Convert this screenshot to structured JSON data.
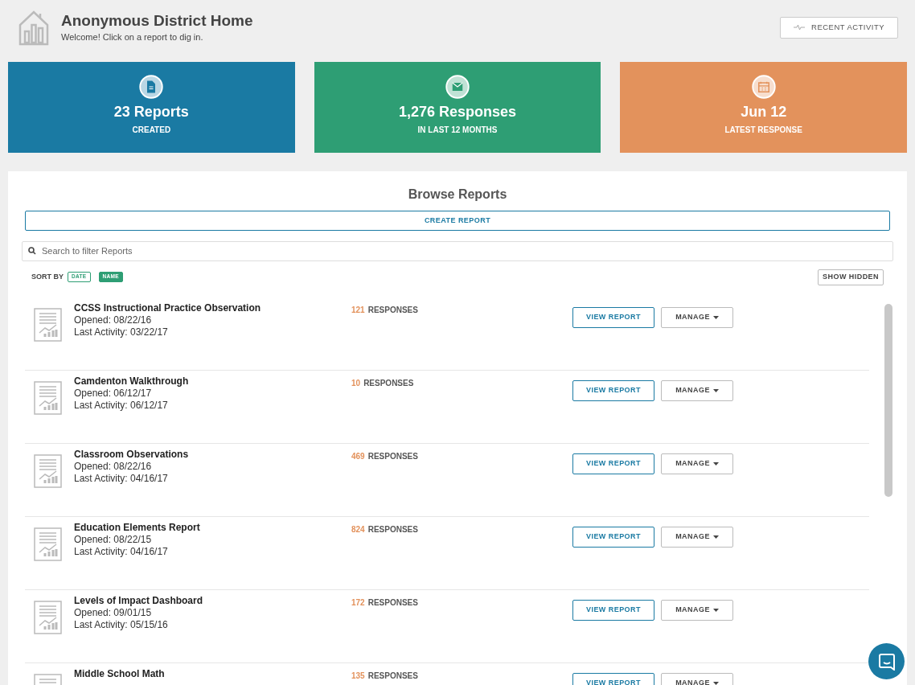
{
  "header": {
    "title": "Anonymous District Home",
    "subtitle": "Welcome! Click on a report to dig in.",
    "recent_activity_button": "RECENT ACTIVITY"
  },
  "stats": [
    {
      "kind": "document",
      "value": "23 Reports",
      "label": "CREATED",
      "color": "#1a7aa3"
    },
    {
      "kind": "envelope",
      "value": "1,276 Responses",
      "label": "IN LAST 12 MONTHS",
      "color": "#2e9e74"
    },
    {
      "kind": "calendar",
      "value": "Jun 12",
      "label": "LATEST RESPONSE",
      "color": "#e3925c"
    }
  ],
  "browse": {
    "title": "Browse Reports",
    "create_button": "CREATE REPORT",
    "search": {
      "placeholder": "Search to filter Reports"
    },
    "sort_label": "SORT BY",
    "sort_options": [
      {
        "label": "DATE",
        "selected": false
      },
      {
        "label": "NAME",
        "selected": true
      }
    ],
    "show_hidden_button": "SHOW HIDDEN",
    "reports": [
      {
        "title": "CCSS Instructional Practice Observation",
        "opened": "Opened: 08/22/16",
        "last_activity": "Last Activity: 03/22/17",
        "count": "121",
        "responses_label": "RESPONSES",
        "view_button": "VIEW REPORT",
        "manage_button": "MANAGE"
      },
      {
        "title": "Camdenton Walkthrough",
        "opened": "Opened: 06/12/17",
        "last_activity": "Last Activity: 06/12/17",
        "count": "10",
        "responses_label": "RESPONSES",
        "view_button": "VIEW REPORT",
        "manage_button": "MANAGE"
      },
      {
        "title": "Classroom Observations",
        "opened": "Opened: 08/22/16",
        "last_activity": "Last Activity: 04/16/17",
        "count": "469",
        "responses_label": "RESPONSES",
        "view_button": "VIEW REPORT",
        "manage_button": "MANAGE"
      },
      {
        "title": "Education Elements Report",
        "opened": "Opened: 08/22/15",
        "last_activity": "Last Activity: 04/16/17",
        "count": "824",
        "responses_label": "RESPONSES",
        "view_button": "VIEW REPORT",
        "manage_button": "MANAGE"
      },
      {
        "title": "Levels of Impact Dashboard",
        "opened": "Opened: 09/01/15",
        "last_activity": "Last Activity: 05/15/16",
        "count": "172",
        "responses_label": "RESPONSES",
        "view_button": "VIEW REPORT",
        "manage_button": "MANAGE"
      },
      {
        "title": "Middle School Math",
        "count": "135",
        "responses_label": "RESPONSES",
        "view_button": "VIEW REPORT",
        "manage_button": "MANAGE"
      }
    ]
  }
}
